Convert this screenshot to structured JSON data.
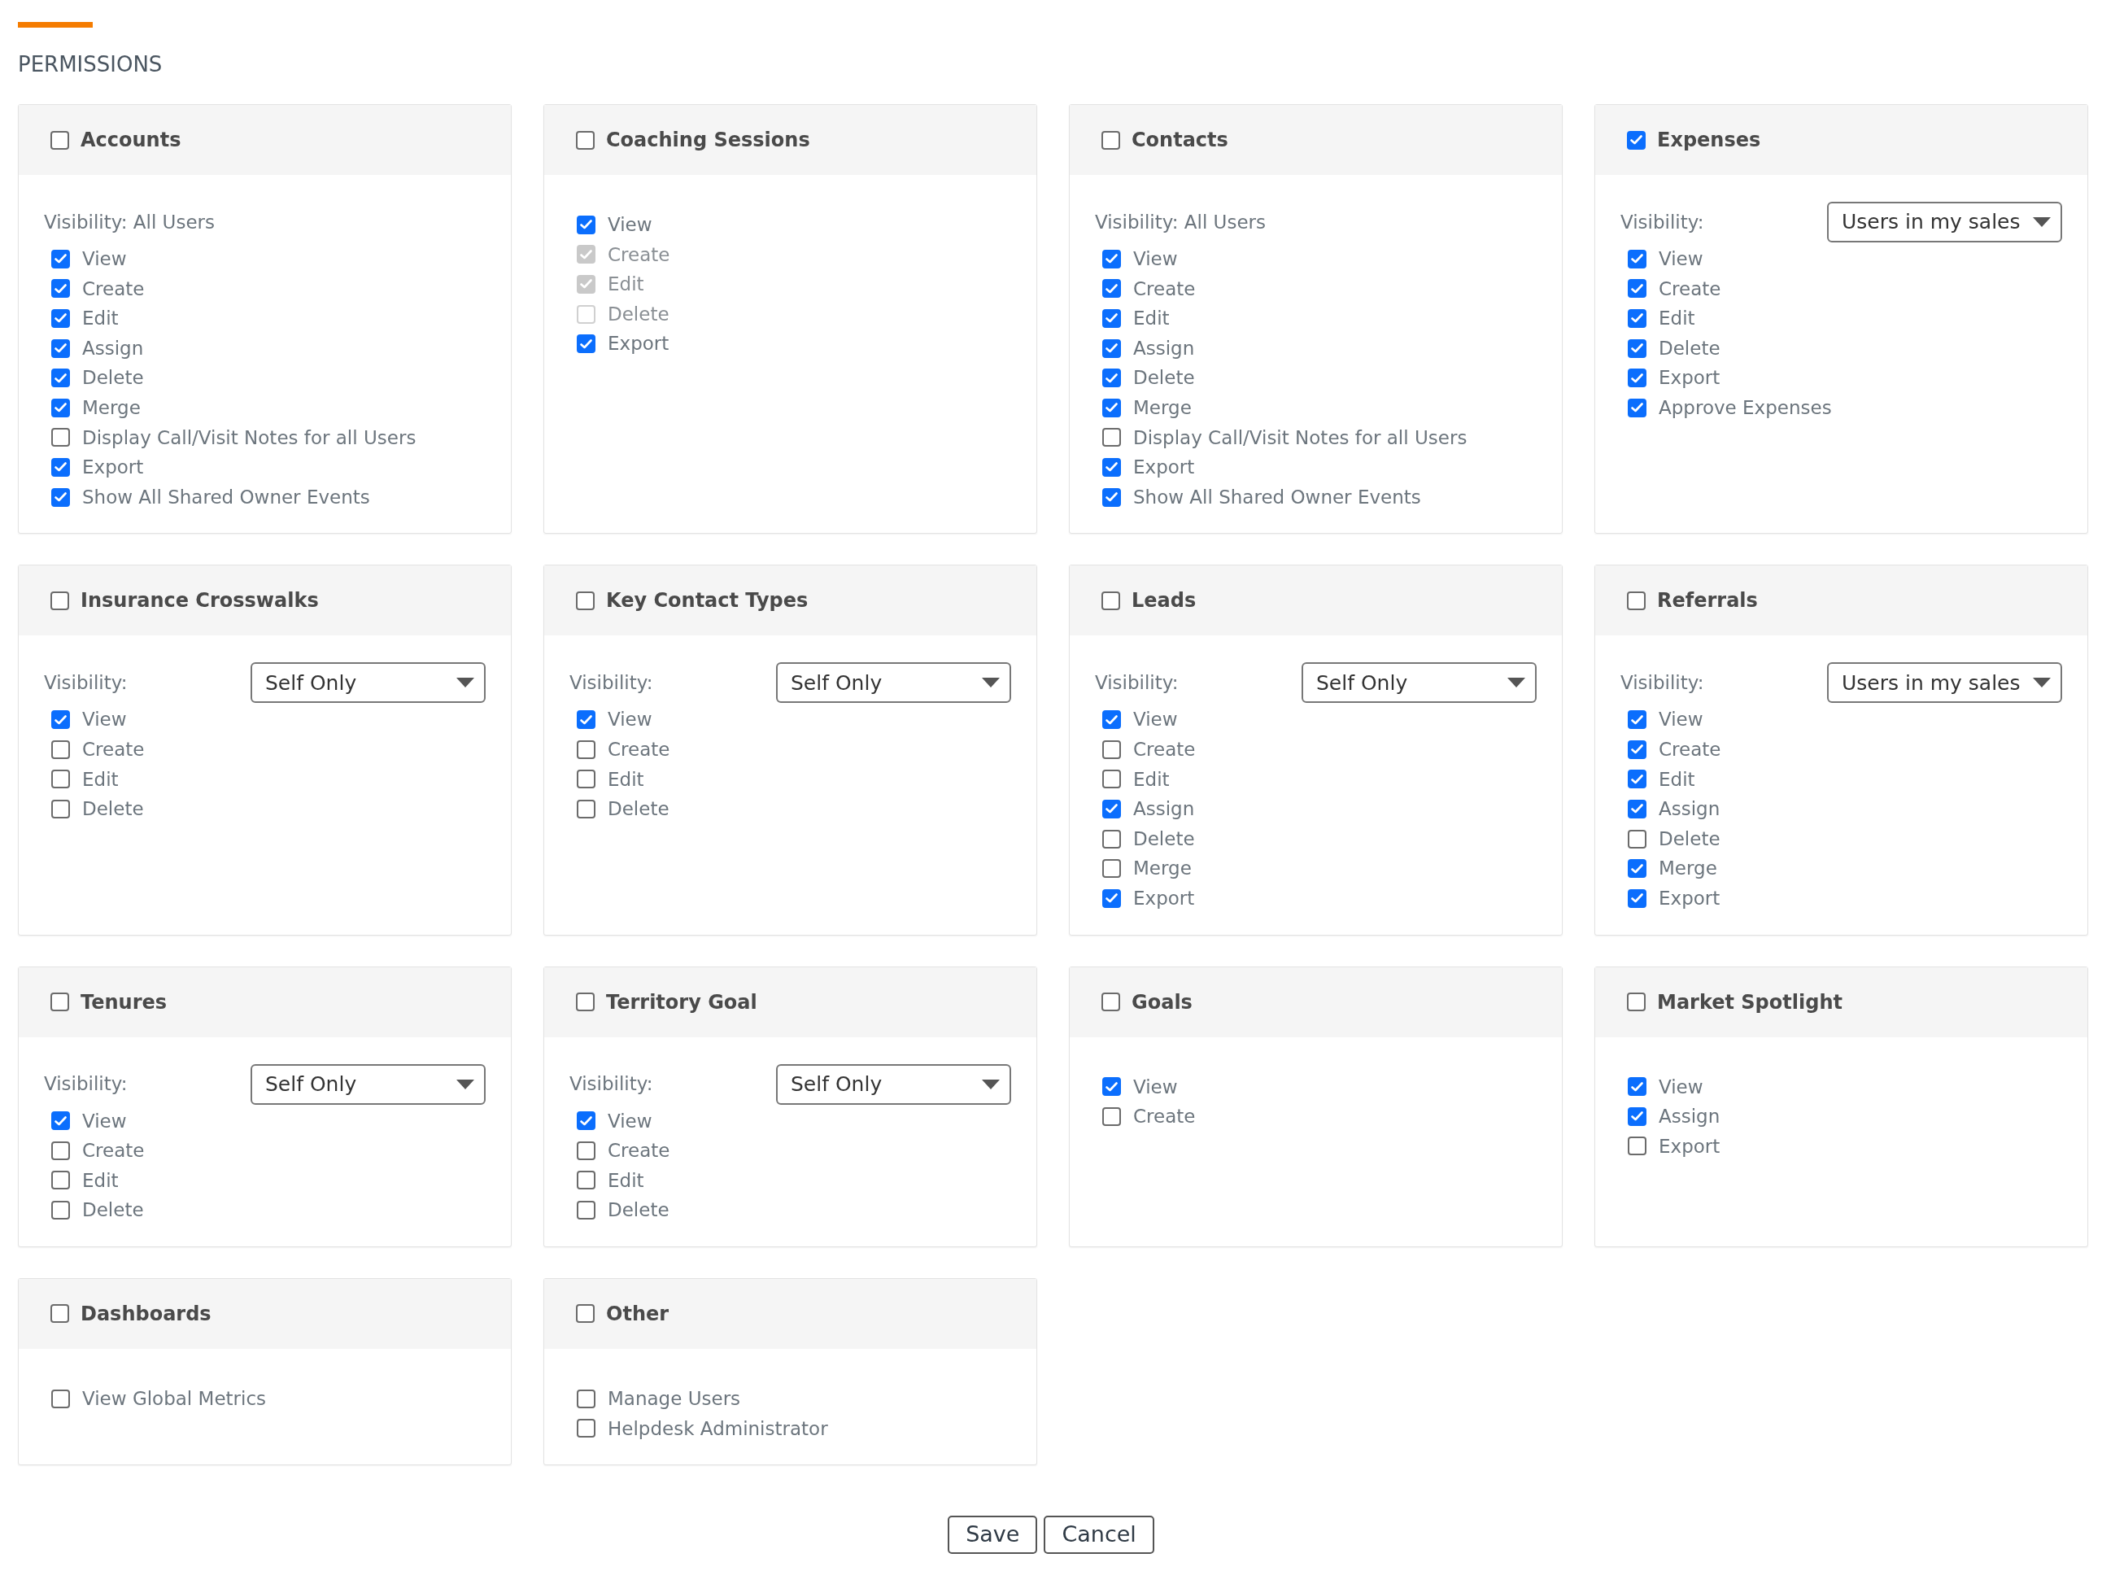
{
  "title": "PERMISSIONS",
  "cards": [
    {
      "name": "Accounts",
      "checked": false,
      "visibility": {
        "kind": "text",
        "label": "Visibility: All Users"
      },
      "items": [
        {
          "label": "View",
          "checked": true
        },
        {
          "label": "Create",
          "checked": true
        },
        {
          "label": "Edit",
          "checked": true
        },
        {
          "label": "Assign",
          "checked": true
        },
        {
          "label": "Delete",
          "checked": true
        },
        {
          "label": "Merge",
          "checked": true
        },
        {
          "label": "Display Call/Visit Notes for all Users",
          "checked": false
        },
        {
          "label": "Export",
          "checked": true
        },
        {
          "label": "Show All Shared Owner Events",
          "checked": true
        }
      ]
    },
    {
      "name": "Coaching Sessions",
      "checked": false,
      "items": [
        {
          "label": "View",
          "checked": true,
          "disabled": false
        },
        {
          "label": "Create",
          "checked": true,
          "disabled": true
        },
        {
          "label": "Edit",
          "checked": true,
          "disabled": true
        },
        {
          "label": "Delete",
          "checked": false,
          "disabled": true
        },
        {
          "label": "Export",
          "checked": true,
          "disabled": false
        }
      ]
    },
    {
      "name": "Contacts",
      "checked": false,
      "visibility": {
        "kind": "text",
        "label": "Visibility: All Users"
      },
      "items": [
        {
          "label": "View",
          "checked": true
        },
        {
          "label": "Create",
          "checked": true
        },
        {
          "label": "Edit",
          "checked": true
        },
        {
          "label": "Assign",
          "checked": true
        },
        {
          "label": "Delete",
          "checked": true
        },
        {
          "label": "Merge",
          "checked": true
        },
        {
          "label": "Display Call/Visit Notes for all Users",
          "checked": false
        },
        {
          "label": "Export",
          "checked": true
        },
        {
          "label": "Show All Shared Owner Events",
          "checked": true
        }
      ]
    },
    {
      "name": "Expenses",
      "checked": true,
      "visibility": {
        "kind": "select",
        "label": "Visibility:",
        "value": "Users in my sales"
      },
      "items": [
        {
          "label": "View",
          "checked": true
        },
        {
          "label": "Create",
          "checked": true
        },
        {
          "label": "Edit",
          "checked": true
        },
        {
          "label": "Delete",
          "checked": true
        },
        {
          "label": "Export",
          "checked": true
        },
        {
          "label": "Approve Expenses",
          "checked": true
        }
      ]
    },
    {
      "name": "Insurance Crosswalks",
      "checked": false,
      "visibility": {
        "kind": "select",
        "label": "Visibility:",
        "value": "Self Only"
      },
      "items": [
        {
          "label": "View",
          "checked": true
        },
        {
          "label": "Create",
          "checked": false
        },
        {
          "label": "Edit",
          "checked": false
        },
        {
          "label": "Delete",
          "checked": false
        }
      ]
    },
    {
      "name": "Key Contact Types",
      "checked": false,
      "visibility": {
        "kind": "select",
        "label": "Visibility:",
        "value": "Self Only"
      },
      "items": [
        {
          "label": "View",
          "checked": true
        },
        {
          "label": "Create",
          "checked": false
        },
        {
          "label": "Edit",
          "checked": false
        },
        {
          "label": "Delete",
          "checked": false
        }
      ]
    },
    {
      "name": "Leads",
      "checked": false,
      "visibility": {
        "kind": "select",
        "label": "Visibility:",
        "value": "Self Only"
      },
      "items": [
        {
          "label": "View",
          "checked": true
        },
        {
          "label": "Create",
          "checked": false
        },
        {
          "label": "Edit",
          "checked": false
        },
        {
          "label": "Assign",
          "checked": true
        },
        {
          "label": "Delete",
          "checked": false
        },
        {
          "label": "Merge",
          "checked": false
        },
        {
          "label": "Export",
          "checked": true
        }
      ]
    },
    {
      "name": "Referrals",
      "checked": false,
      "visibility": {
        "kind": "select",
        "label": "Visibility:",
        "value": "Users in my sales"
      },
      "items": [
        {
          "label": "View",
          "checked": true
        },
        {
          "label": "Create",
          "checked": true
        },
        {
          "label": "Edit",
          "checked": true
        },
        {
          "label": "Assign",
          "checked": true
        },
        {
          "label": "Delete",
          "checked": false
        },
        {
          "label": "Merge",
          "checked": true
        },
        {
          "label": "Export",
          "checked": true
        }
      ]
    },
    {
      "name": "Tenures",
      "checked": false,
      "visibility": {
        "kind": "select",
        "label": "Visibility:",
        "value": "Self Only"
      },
      "items": [
        {
          "label": "View",
          "checked": true
        },
        {
          "label": "Create",
          "checked": false
        },
        {
          "label": "Edit",
          "checked": false
        },
        {
          "label": "Delete",
          "checked": false
        }
      ]
    },
    {
      "name": "Territory Goal",
      "checked": false,
      "visibility": {
        "kind": "select",
        "label": "Visibility:",
        "value": "Self Only"
      },
      "items": [
        {
          "label": "View",
          "checked": true
        },
        {
          "label": "Create",
          "checked": false
        },
        {
          "label": "Edit",
          "checked": false
        },
        {
          "label": "Delete",
          "checked": false
        }
      ]
    },
    {
      "name": "Goals",
      "checked": false,
      "items": [
        {
          "label": "View",
          "checked": true
        },
        {
          "label": "Create",
          "checked": false
        }
      ]
    },
    {
      "name": "Market Spotlight",
      "checked": false,
      "items": [
        {
          "label": "View",
          "checked": true
        },
        {
          "label": "Assign",
          "checked": true
        },
        {
          "label": "Export",
          "checked": false
        }
      ]
    },
    {
      "name": "Dashboards",
      "checked": false,
      "items": [
        {
          "label": "View Global Metrics",
          "checked": false
        }
      ]
    },
    {
      "name": "Other",
      "checked": false,
      "items": [
        {
          "label": "Manage Users",
          "checked": false
        },
        {
          "label": "Helpdesk Administrator",
          "checked": false
        }
      ]
    }
  ],
  "buttons": [
    "Save",
    "Cancel"
  ]
}
